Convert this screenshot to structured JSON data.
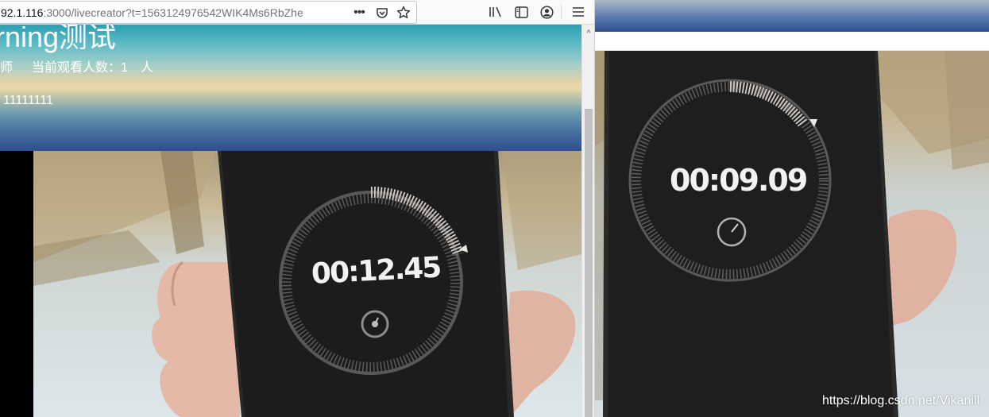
{
  "browser": {
    "url_host": "92.1.116",
    "url_rest": ":3000/livecreator?t=1563124976542WIK4Ms6RbZhe",
    "icons": [
      "more-actions-icon",
      "pocket-icon",
      "bookmark-star-icon",
      "library-icon",
      "sidebar-icon",
      "account-icon",
      "menu-icon"
    ]
  },
  "live_page": {
    "title": "rning测试",
    "teacher_label": "老师",
    "viewers_label": "当前观看人数：1　人",
    "description": "11111111"
  },
  "left_video": {
    "timer_text": "00:12.45"
  },
  "right_video": {
    "timer_text": "00:09.09"
  },
  "watermark": "https://blog.csdn.net/Vikanill",
  "colors": {
    "hero_top": "#2aa0b2",
    "hero_mid": "#ecd9a7",
    "hero_bottom": "#2f4d8e"
  }
}
